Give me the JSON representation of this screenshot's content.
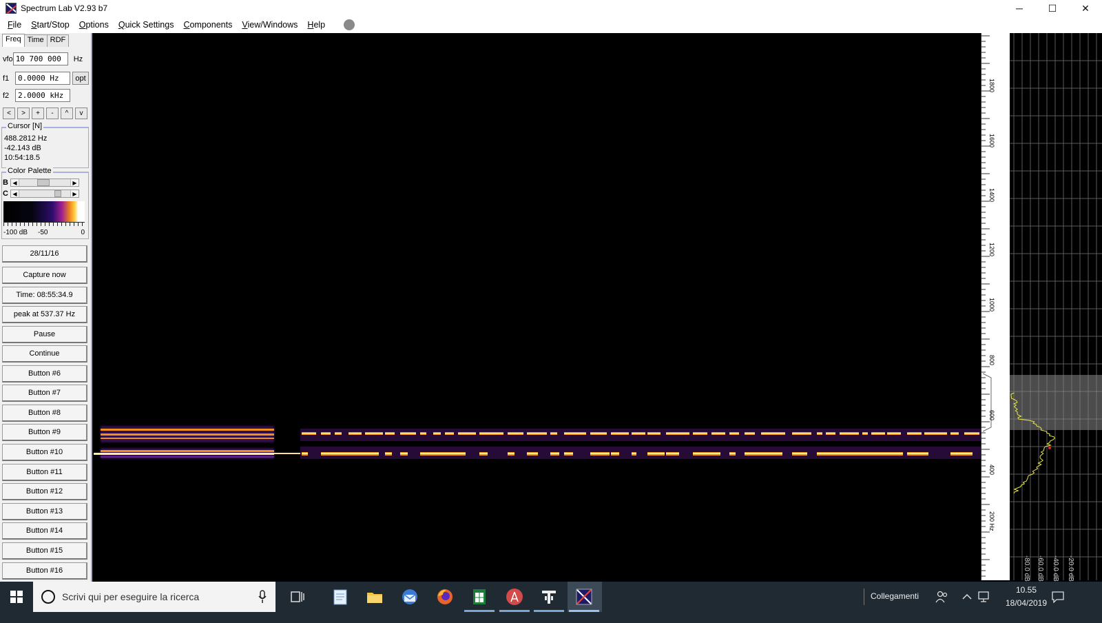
{
  "window": {
    "title": "Spectrum Lab V2.93 b7",
    "minimize": "─",
    "maximize": "☐",
    "close": "✕"
  },
  "menu": [
    {
      "u": "F",
      "rest": "ile"
    },
    {
      "u": "S",
      "rest": "tart/Stop"
    },
    {
      "u": "O",
      "rest": "ptions"
    },
    {
      "u": "Q",
      "rest": "uick Settings"
    },
    {
      "u": "C",
      "rest": "omponents"
    },
    {
      "u": "V",
      "rest": "iew/Windows"
    },
    {
      "u": "H",
      "rest": "elp"
    }
  ],
  "tabs": [
    "Freq",
    "Time",
    "RDF"
  ],
  "freq": {
    "vfo_label": "vfo",
    "vfo_value": "10 700 000",
    "vfo_unit": "Hz",
    "f1_label": "f1",
    "f1_value": "0.0000 Hz",
    "opt_label": "opt",
    "f2_label": "f2",
    "f2_value": "2.0000 kHz"
  },
  "nav_buttons": [
    "<",
    ">",
    "+",
    "-",
    "^",
    "v"
  ],
  "cursor": {
    "title": "Cursor [N]",
    "freq": "488.2812 Hz",
    "level": "-42.143 dB",
    "time": "10:54:18.5"
  },
  "palette": {
    "title": "Color Palette",
    "b_label": "B",
    "c_label": "C",
    "lbl_min": "-100 dB",
    "lbl_mid": "-50",
    "lbl_max": "0"
  },
  "buttons": [
    "28/11/16",
    "Capture now",
    "Time:  08:55:34.9",
    "peak at 537.37 Hz",
    "Pause",
    "Continue",
    "Button #6",
    "Button #7",
    "Button #8",
    "Button #9",
    "Button #10",
    "Button #11",
    "Button #12",
    "Button #13",
    "Button #14",
    "Button #15",
    "Button #16"
  ],
  "freq_axis": {
    "labels": [
      "1800",
      "1600",
      "1400",
      "1200",
      "1000",
      "800",
      "600",
      "400",
      "200 Hz"
    ]
  },
  "level_axis": {
    "labels": [
      "-80.0 dB",
      "-60.0 dB",
      "-40.0 dB",
      "-20.0 dB"
    ]
  },
  "taskbar": {
    "search_placeholder": "Scrivi qui per eseguire la ricerca",
    "links_label": "Collegamenti",
    "time": "10.55",
    "date": "18/04/2019"
  },
  "colors": {
    "signal_core": "#fff0a0",
    "signal_orange": "#f0901c",
    "signal_purple": "#6a1f9c",
    "spectrum_line": "#e8e84a"
  }
}
